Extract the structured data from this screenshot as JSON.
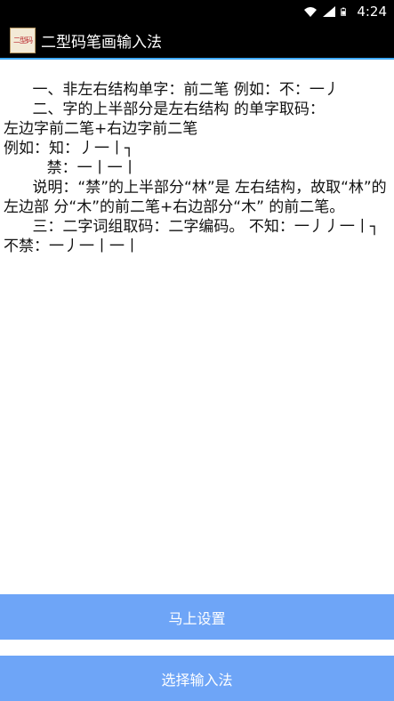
{
  "status_bar": {
    "time": "4:24",
    "icons": [
      "wifi-icon",
      "signal-icon",
      "battery-icon"
    ]
  },
  "action_bar": {
    "logo_text": "二型码",
    "title": "二型码笔画输入法"
  },
  "content": {
    "lines": [
      "      一、非左右结构单字：前二笔 例如：不：一丿",
      "      二、字的上半部分是左右结构 的单字取码：",
      "左边字前二笔+右边字前二笔",
      "例如：知：丿一丨┐",
      "         禁：一丨一丨",
      "      说明：“禁”的上半部分“林”是 左右结构，故取“林”的左边部 分“木”的前二笔+右边部分“木” 的前二笔。",
      "      三：二字词组取码：二字编码。 不知：一丿丿一丨┐不禁：一丿一丨一丨"
    ]
  },
  "buttons": {
    "setup": "马上设置",
    "choose": "选择输入法"
  },
  "colors": {
    "button_bg": "#6ea5f7",
    "action_bar_accent": "#3fa9f5"
  }
}
